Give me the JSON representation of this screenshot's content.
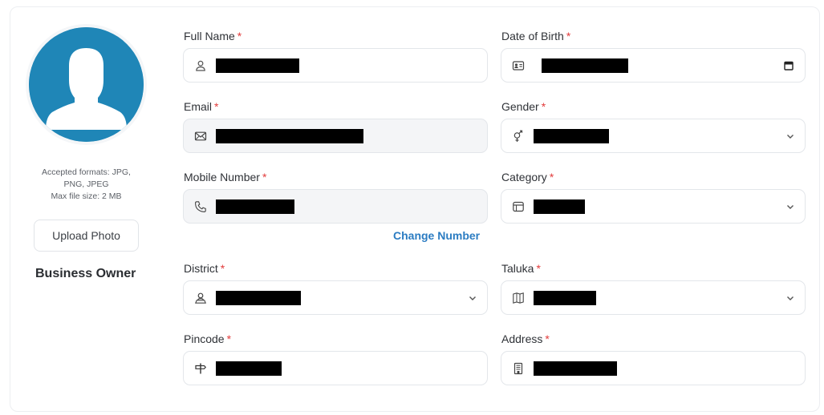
{
  "profile": {
    "formats_line1": "Accepted formats: JPG,",
    "formats_line2": "PNG, JPEG",
    "max_size": "Max file size: 2 MB",
    "upload_label": "Upload Photo",
    "role": "Business Owner",
    "avatar_color": "#1f86b7"
  },
  "fields": {
    "full_name": {
      "label": "Full Name",
      "icon": "user-icon"
    },
    "dob": {
      "label": "Date of Birth",
      "icon": "id-card-icon"
    },
    "email": {
      "label": "Email",
      "icon": "mail-icon"
    },
    "gender": {
      "label": "Gender",
      "icon": "gender-icon"
    },
    "mobile": {
      "label": "Mobile Number",
      "icon": "phone-icon"
    },
    "category": {
      "label": "Category",
      "icon": "category-icon"
    },
    "district": {
      "label": "District",
      "icon": "location-user-icon"
    },
    "taluka": {
      "label": "Taluka",
      "icon": "map-icon"
    },
    "pincode": {
      "label": "Pincode",
      "icon": "signpost-icon"
    },
    "address": {
      "label": "Address",
      "icon": "building-icon"
    }
  },
  "required_mark": "*",
  "change_number": "Change Number",
  "colors": {
    "required": "#e23b3b",
    "link": "#2b7cc2"
  }
}
